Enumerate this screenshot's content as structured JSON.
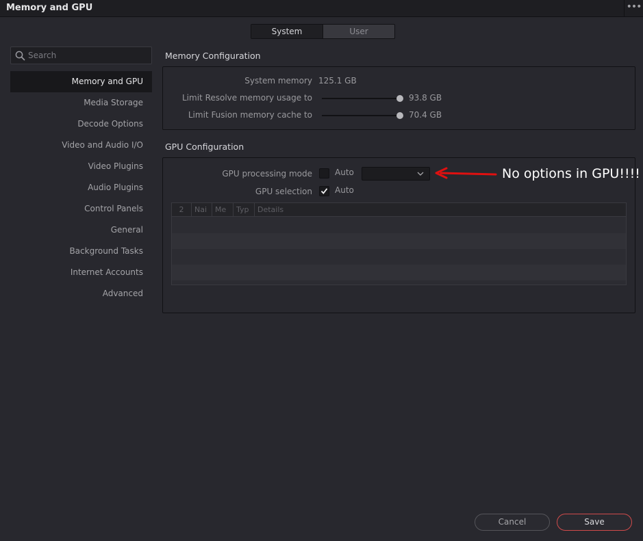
{
  "window": {
    "title": "Memory and GPU",
    "more_label": "•••"
  },
  "tabs": [
    {
      "label": "System",
      "active": true
    },
    {
      "label": "User",
      "active": false
    }
  ],
  "search": {
    "placeholder": "Search",
    "value": ""
  },
  "sidebar": {
    "items": [
      {
        "label": "Memory and GPU",
        "active": true
      },
      {
        "label": "Media Storage"
      },
      {
        "label": "Decode Options"
      },
      {
        "label": "Video and Audio I/O"
      },
      {
        "label": "Video Plugins"
      },
      {
        "label": "Audio Plugins"
      },
      {
        "label": "Control Panels"
      },
      {
        "label": "General"
      },
      {
        "label": "Background Tasks"
      },
      {
        "label": "Internet Accounts"
      },
      {
        "label": "Advanced"
      }
    ]
  },
  "memory": {
    "section_title": "Memory Configuration",
    "system_memory_label": "System memory",
    "system_memory_value": "125.1 GB",
    "resolve_limit_label": "Limit Resolve memory usage to",
    "resolve_limit_value": "93.8 GB",
    "resolve_limit_fraction": 1.0,
    "fusion_limit_label": "Limit Fusion memory cache to",
    "fusion_limit_value": "70.4 GB",
    "fusion_limit_fraction": 1.0
  },
  "gpu": {
    "section_title": "GPU Configuration",
    "processing_mode_label": "GPU processing mode",
    "processing_mode_auto_label": "Auto",
    "processing_mode_auto_checked": false,
    "processing_mode_value": "",
    "selection_label": "GPU selection",
    "selection_auto_label": "Auto",
    "selection_auto_checked": true,
    "table_headers": [
      "2",
      "Nai",
      "Me",
      "Typ",
      "Details"
    ]
  },
  "annotation": {
    "text": "No options in GPU!!!!",
    "color": "#e01010"
  },
  "footer": {
    "cancel_label": "Cancel",
    "save_label": "Save"
  },
  "colors": {
    "accent_save_border": "#d24b4b",
    "background": "#28282e"
  }
}
